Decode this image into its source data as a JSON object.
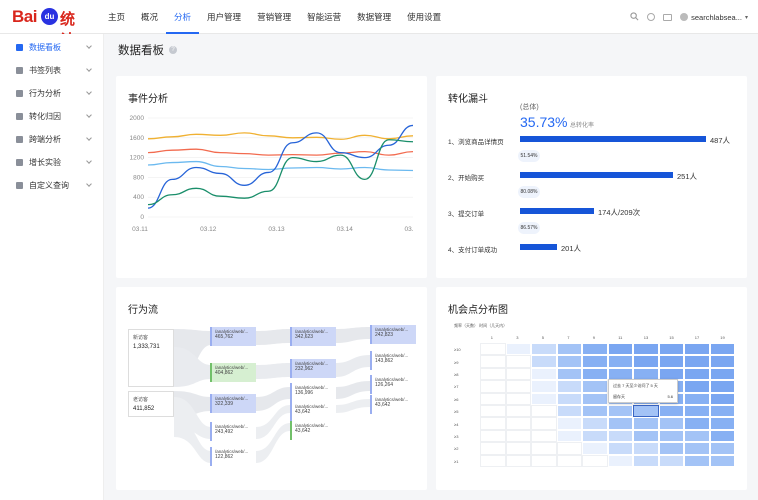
{
  "logo": {
    "bai": "Bai",
    "paw": "du",
    "tongji": "统计"
  },
  "nav": [
    "主页",
    "概况",
    "分析",
    "用户管理",
    "营销管理",
    "智能运营",
    "数据管理",
    "使用设置"
  ],
  "user": {
    "name": "searchlabsea..."
  },
  "sidebar": [
    {
      "label": "数据看板",
      "icon": "dashboard-icon"
    },
    {
      "label": "书签列表",
      "icon": "bookmark-icon"
    },
    {
      "label": "行为分析",
      "icon": "behavior-icon"
    },
    {
      "label": "转化归因",
      "icon": "attribution-icon"
    },
    {
      "label": "跨端分析",
      "icon": "cross-device-icon"
    },
    {
      "label": "增长实验",
      "icon": "experiment-icon"
    },
    {
      "label": "自定义查询",
      "icon": "query-icon"
    }
  ],
  "page": {
    "title": "数据看板"
  },
  "events": {
    "title": "事件分析",
    "chart_data": {
      "type": "line",
      "x": [
        "03.11",
        "03.12",
        "03.13",
        "03.14",
        "03."
      ],
      "yticks": [
        0,
        400,
        800,
        1200,
        1600,
        2000
      ],
      "ylim": [
        0,
        2000
      ],
      "series": [
        {
          "color": "#f0b132",
          "values": [
            1580,
            1620,
            1670,
            1650,
            1700,
            1640,
            1600,
            1610,
            1570,
            1650,
            1580,
            1640
          ]
        },
        {
          "color": "#f26b4f",
          "values": [
            1300,
            1350,
            1370,
            1300,
            1280,
            1250,
            1260,
            1250,
            1290,
            1320,
            1250,
            1320
          ]
        },
        {
          "color": "#6bb9ef",
          "values": [
            1050,
            1100,
            1120,
            1020,
            980,
            960,
            990,
            1000,
            970,
            1000,
            950,
            940
          ]
        },
        {
          "color": "#2764d8",
          "values": [
            180,
            760,
            1000,
            880,
            640,
            900,
            1500,
            1700,
            1300,
            1200,
            1450,
            1850
          ]
        },
        {
          "color": "#1a8e6a",
          "values": [
            250,
            450,
            580,
            420,
            380,
            520,
            1200,
            1120,
            1250,
            760,
            1560,
            1520
          ]
        }
      ]
    }
  },
  "funnel": {
    "title": "转化漏斗",
    "total_label": "(总体)",
    "rate": "35.73%",
    "rate_label": "总转化率",
    "steps": [
      {
        "label": "1、浏览商品详情页",
        "value": "487人",
        "frac": 1.0
      },
      {
        "label": "2、开始购买",
        "value": "251人",
        "frac": 0.82
      },
      {
        "label": "3、提交订单",
        "value": "174人/209次",
        "frac": 0.4
      },
      {
        "label": "4、支付订单成功",
        "value": "201人",
        "frac": 0.2
      }
    ],
    "pcts": [
      "51.54%",
      "80.08%",
      "86.57%"
    ]
  },
  "flow": {
    "title": "行为流",
    "sources": [
      {
        "label": "新访客",
        "value": "1,333,731"
      },
      {
        "label": "老访客",
        "value": "411,852"
      }
    ],
    "col1": [
      {
        "label": "/analytics/web/...",
        "value": "465,762"
      },
      {
        "label": "/analytics/web/...",
        "value": "404,862"
      },
      {
        "label": "/analytics/web/...",
        "value": "322,339"
      },
      {
        "label": "/analytics/web/...",
        "value": "243,492"
      },
      {
        "label": "/analytics/web/...",
        "value": "122,862"
      }
    ],
    "col2": [
      {
        "label": "/analytics/web/...",
        "value": "342,623"
      },
      {
        "label": "/analytics/web/...",
        "value": "232,962"
      },
      {
        "label": "/analytics/web/...",
        "value": "136,996"
      },
      {
        "label": "/analytics/web/...",
        "value": "43,642"
      },
      {
        "label": "/analytics/web/...",
        "value": "43,642"
      }
    ],
    "col3": [
      {
        "label": "/analytics/web/...",
        "value": "242,823"
      },
      {
        "label": "/analytics/web/...",
        "value": "143,862"
      },
      {
        "label": "/analytics/web/...",
        "value": "126,264"
      },
      {
        "label": "/analytics/web/...",
        "value": "43,642"
      }
    ]
  },
  "heatmap": {
    "title": "机会点分布图",
    "top_label": "频率（天数） 时间（几天内）",
    "cols": [
      "1",
      "3",
      "5",
      "7",
      "9",
      "11",
      "13",
      "15",
      "17",
      "19"
    ],
    "rows": [
      "≥10",
      "≥9",
      "≥8",
      "≥7",
      "≥6",
      "≥5",
      "≥4",
      "≥3",
      "≥2",
      "≥1"
    ],
    "tooltip": {
      "line1": "过去 7 天至少访问了 5 天",
      "line2": "留存天",
      "value": "5.6"
    },
    "chart_data": {
      "type": "heatmap",
      "x": [
        "1",
        "3",
        "5",
        "7",
        "9",
        "11",
        "13",
        "15",
        "17",
        "19"
      ],
      "y": [
        "≥10",
        "≥9",
        "≥8",
        "≥7",
        "≥6",
        "≥5",
        "≥4",
        "≥3",
        "≥2",
        "≥1"
      ],
      "values": [
        [
          0,
          1,
          2,
          3,
          4,
          5,
          5,
          5,
          5,
          5
        ],
        [
          0,
          0,
          2,
          3,
          4,
          4,
          5,
          5,
          5,
          5
        ],
        [
          0,
          0,
          1,
          3,
          4,
          4,
          4,
          5,
          5,
          5
        ],
        [
          0,
          0,
          1,
          2,
          3,
          4,
          4,
          4,
          5,
          5
        ],
        [
          0,
          0,
          1,
          2,
          3,
          3,
          4,
          4,
          4,
          5
        ],
        [
          0,
          0,
          0,
          2,
          3,
          3,
          3,
          4,
          4,
          4
        ],
        [
          0,
          0,
          0,
          1,
          2,
          3,
          3,
          3,
          4,
          4
        ],
        [
          0,
          0,
          0,
          1,
          2,
          2,
          3,
          3,
          3,
          4
        ],
        [
          0,
          0,
          0,
          0,
          1,
          2,
          2,
          3,
          3,
          3
        ],
        [
          0,
          0,
          0,
          0,
          0,
          1,
          2,
          2,
          3,
          3
        ]
      ]
    }
  }
}
